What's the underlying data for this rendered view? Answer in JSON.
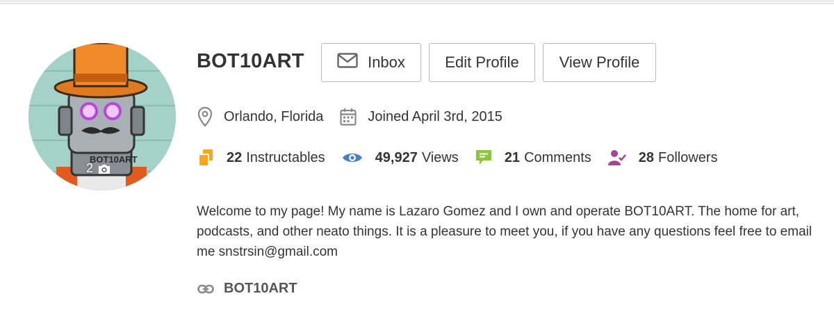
{
  "profile": {
    "username": "BOT10ART",
    "photo_count": "2",
    "location": "Orlando, Florida",
    "joined": "Joined April 3rd, 2015",
    "bio": "Welcome to my page! My name is Lazaro Gomez and I own and operate BOT10ART. The home for art, podcasts, and other neato things. It is a pleasure to meet you, if you have any questions feel free to email me snstrsin@gmail.com",
    "link_label": "BOT10ART"
  },
  "buttons": {
    "inbox": "Inbox",
    "edit": "Edit Profile",
    "view": "View Profile"
  },
  "stats": {
    "instructables": {
      "count": "22",
      "label": "Instructables",
      "color": "#f7a81b"
    },
    "views": {
      "count": "49,927",
      "label": "Views",
      "color": "#4a7fc1"
    },
    "comments": {
      "count": "21",
      "label": "Comments",
      "color": "#8cc63f"
    },
    "followers": {
      "count": "28",
      "label": "Followers",
      "color": "#a3449a"
    }
  },
  "icons": {
    "inbox": "envelope-icon",
    "location": "map-pin-icon",
    "joined": "calendar-icon",
    "instructables": "stack-icon",
    "views": "eye-icon",
    "comments": "speech-bubble-icon",
    "followers": "user-check-icon",
    "link": "chain-link-icon",
    "photo": "camera-icon"
  }
}
